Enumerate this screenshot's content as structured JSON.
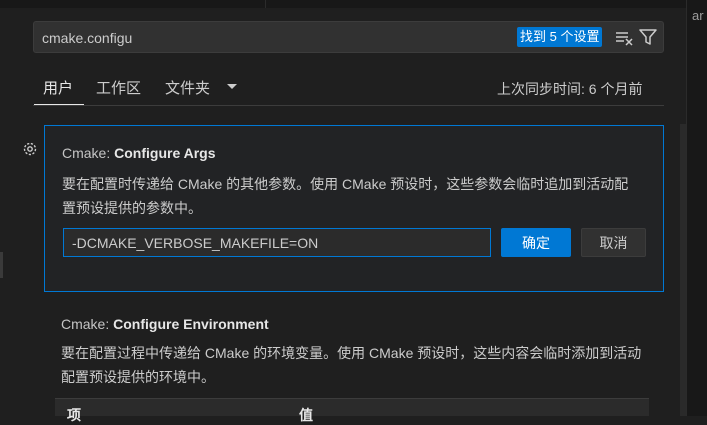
{
  "search": {
    "value": "cmake.configu",
    "result_badge": "找到 5 个设置"
  },
  "tabs": [
    {
      "label": "用户",
      "active": true
    },
    {
      "label": "工作区",
      "active": false
    },
    {
      "label": "文件夹",
      "active": false
    }
  ],
  "sync_status": "上次同步时间: 6 个月前",
  "gutter_text": "ar",
  "settings": [
    {
      "category": "Cmake: ",
      "name": "Configure Args",
      "description": "要在配置时传递给 CMake 的其他参数。使用 CMake 预设时，这些参数会临时追加到活动配置预设提供的参数中。",
      "edit_value": "-DCMAKE_VERBOSE_MAKEFILE=ON",
      "ok_label": "确定",
      "cancel_label": "取消"
    },
    {
      "category": "Cmake: ",
      "name": "Configure Environment",
      "description": "要在配置过程中传递给 CMake 的环境变量。使用 CMake 预设时，这些内容会临时添加到活动配置预设提供的环境中。",
      "table_columns": [
        "项",
        "值"
      ]
    }
  ],
  "colors": {
    "accent": "#0078d4",
    "background": "#1f1f1f",
    "text": "#cccccc"
  },
  "icons": [
    "clear-filter-icon",
    "filter-icon",
    "chevron-down-icon",
    "gear-icon"
  ]
}
